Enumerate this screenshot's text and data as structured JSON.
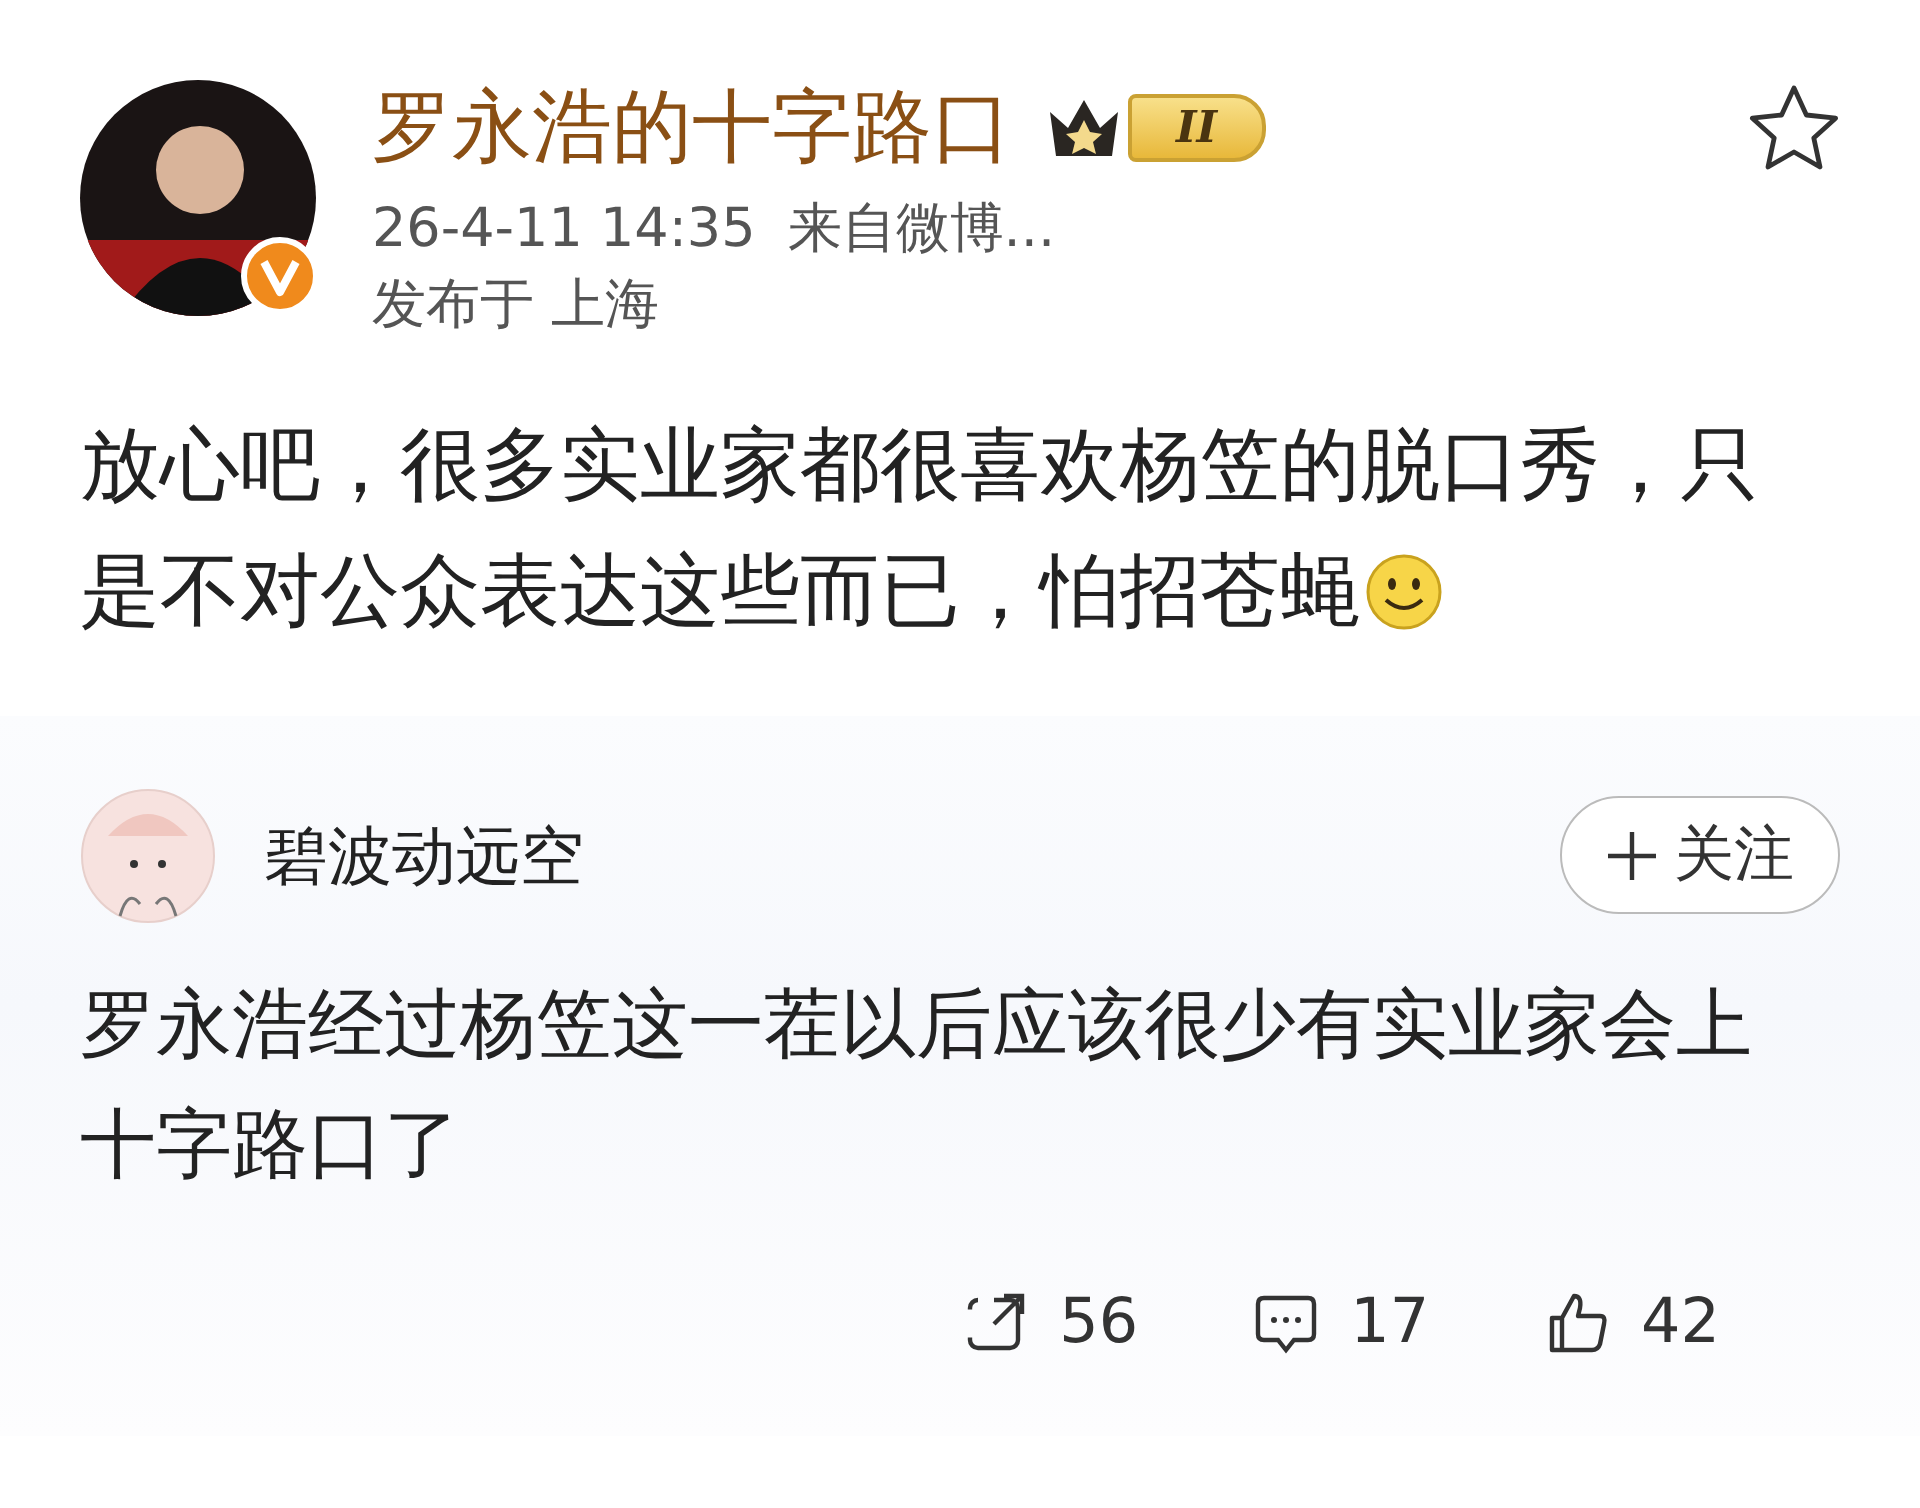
{
  "post": {
    "author": "罗永浩的十字路口",
    "level_badge": "II",
    "verified": true,
    "favorited": false,
    "time": "26-4-11 14:35",
    "source": "来自微博...",
    "location": "发布于 上海",
    "text_lines": [
      "放心吧，很多实业家都很喜欢杨笠的脱口秀，只",
      "是不对公众表达这些而已，怕招苍蝇"
    ]
  },
  "comment": {
    "author": "碧波动远空",
    "follow_label": "关注",
    "text_lines": [
      "罗永浩经过杨笠这一茬以后应该很少有实业家会上",
      "十字路口了"
    ]
  },
  "actions": [
    {
      "kind": "repost",
      "count": "56"
    },
    {
      "kind": "comment",
      "count": "17"
    },
    {
      "kind": "like",
      "count": "42"
    }
  ]
}
